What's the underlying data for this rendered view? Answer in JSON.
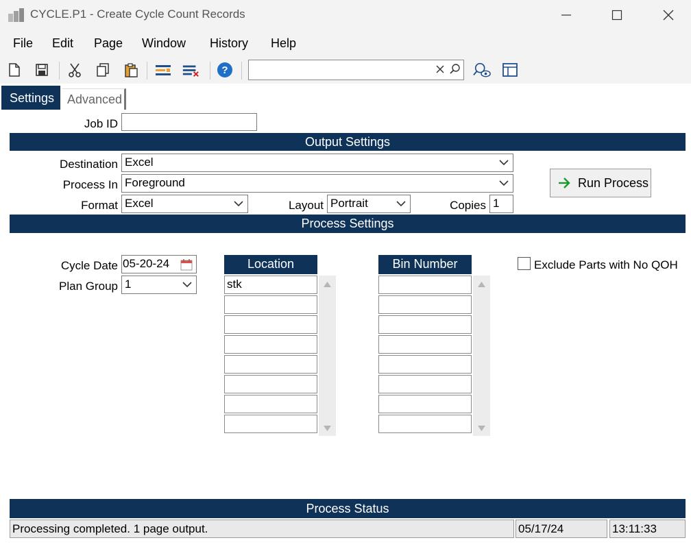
{
  "window": {
    "title": "CYCLE.P1 - Create Cycle Count Records"
  },
  "menu": [
    "File",
    "Edit",
    "Page",
    "Window",
    "History",
    "Help"
  ],
  "toolbar": {
    "search_value": ""
  },
  "tabs": [
    {
      "label": "Settings",
      "active": true
    },
    {
      "label": "Advanced",
      "active": false
    }
  ],
  "job": {
    "label": "Job ID",
    "value": ""
  },
  "output_settings": {
    "title": "Output Settings",
    "destination_label": "Destination",
    "destination_value": "Excel",
    "process_in_label": "Process In",
    "process_in_value": "Foreground",
    "format_label": "Format",
    "format_value": "Excel",
    "layout_label": "Layout",
    "layout_value": "Portrait",
    "copies_label": "Copies",
    "copies_value": "1",
    "run_label": "Run Process"
  },
  "process_settings": {
    "title": "Process Settings",
    "cycle_date_label": "Cycle Date",
    "cycle_date_value": "05-20-24",
    "plan_group_label": "Plan Group",
    "plan_group_value": "1",
    "location_header": "Location",
    "locations": [
      "stk",
      "",
      "",
      "",
      "",
      "",
      "",
      ""
    ],
    "bin_header": "Bin Number",
    "bins": [
      "",
      "",
      "",
      "",
      "",
      "",
      "",
      ""
    ],
    "exclude_label": "Exclude Parts with No QOH",
    "exclude_checked": false
  },
  "status": {
    "title": "Process Status",
    "message": "Processing completed.  1 page output.",
    "date": "05/17/24",
    "time": "13:11:33"
  },
  "colors": {
    "header_bg": "#0f3358",
    "run_arrow": "#1a9a2a"
  }
}
